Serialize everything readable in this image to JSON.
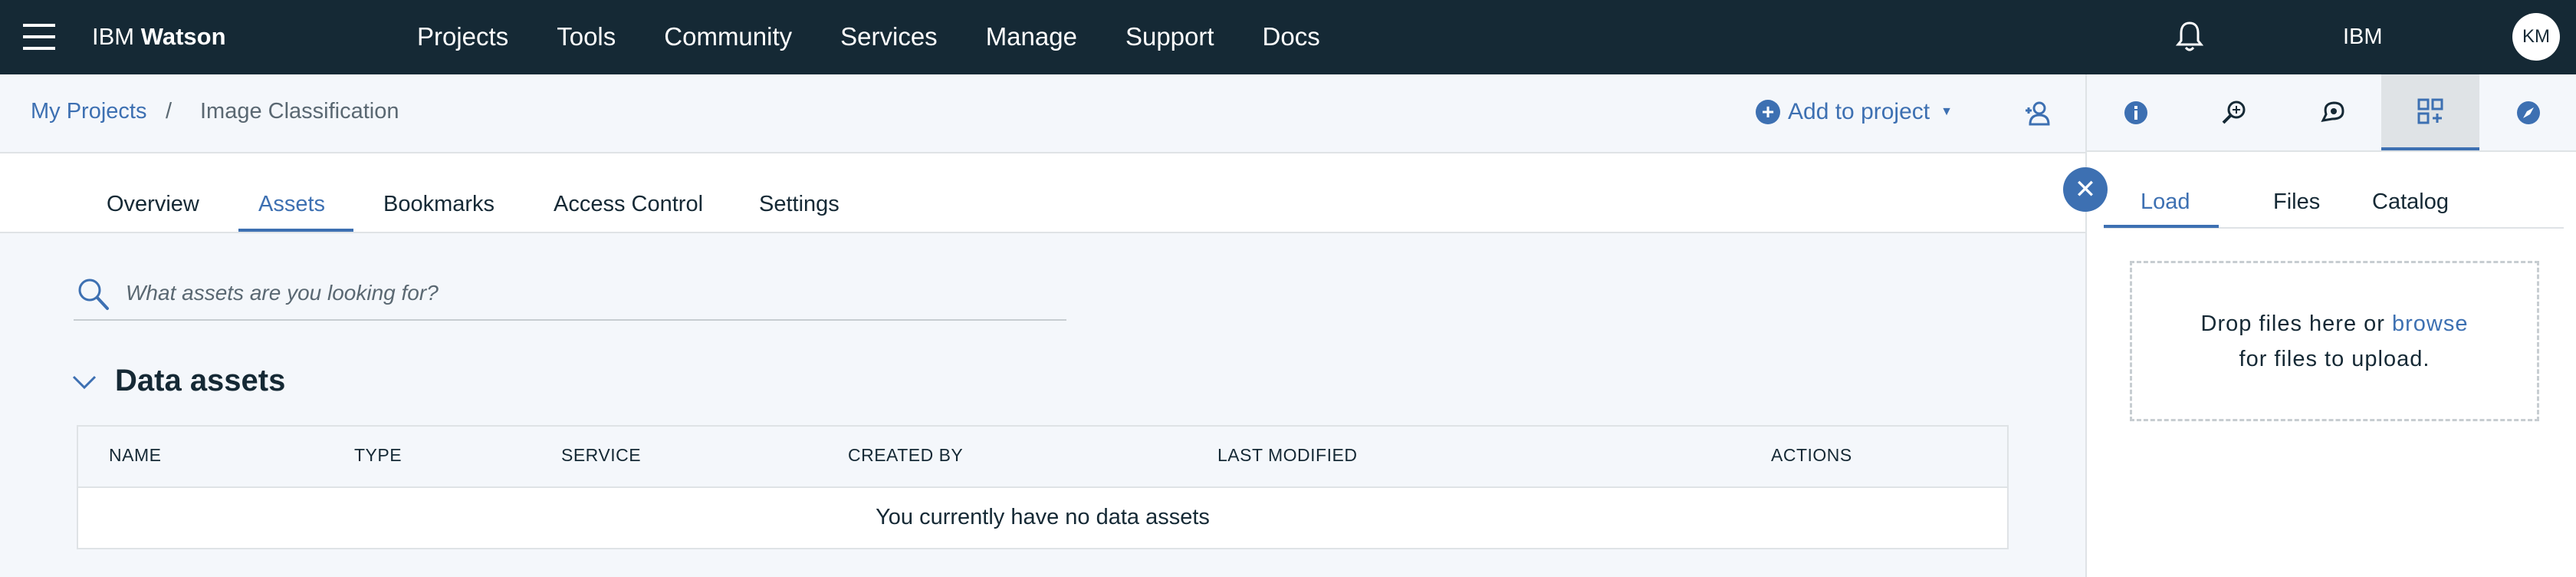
{
  "topbar": {
    "brand_prefix": "IBM",
    "brand_name": "Watson",
    "nav": [
      "Projects",
      "Tools",
      "Community",
      "Services",
      "Manage",
      "Support",
      "Docs"
    ],
    "account": "IBM",
    "avatar_initials": "KM"
  },
  "breadcrumb": {
    "root": "My Projects",
    "separator": "/",
    "current": "Image Classification"
  },
  "actions": {
    "add_to_project": "Add to project"
  },
  "tabs": [
    "Overview",
    "Assets",
    "Bookmarks",
    "Access Control",
    "Settings"
  ],
  "active_tab": "Assets",
  "search": {
    "placeholder": "What assets are you looking for?"
  },
  "data_assets": {
    "title": "Data assets",
    "columns": [
      "NAME",
      "TYPE",
      "SERVICE",
      "CREATED BY",
      "LAST MODIFIED",
      "ACTIONS"
    ],
    "empty_message": "You currently have no data assets"
  },
  "side_panel": {
    "icons": [
      "info-icon",
      "find-data-icon",
      "chat-icon",
      "data-icon",
      "compass-icon"
    ],
    "tabs": [
      "Load",
      "Files",
      "Catalog"
    ],
    "active_tab": "Load",
    "drop_text_1": "Drop files here or",
    "browse": "browse",
    "drop_text_2": "for files to upload."
  },
  "colors": {
    "topbar": "#152935",
    "accent": "#3d70b2",
    "background": "#f4f7fb"
  }
}
